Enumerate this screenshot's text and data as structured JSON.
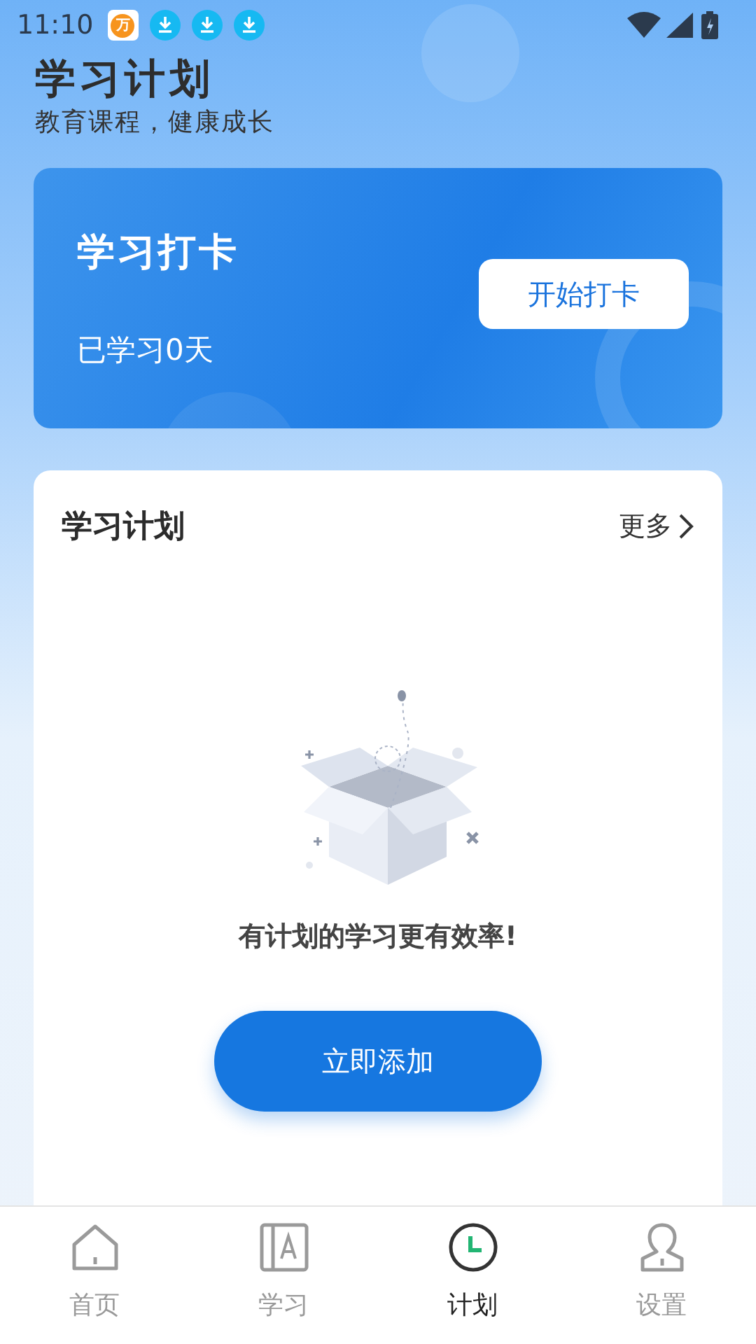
{
  "status_bar": {
    "time": "11:10",
    "notifications": [
      {
        "kind": "app",
        "badge": "万"
      },
      {
        "kind": "download"
      },
      {
        "kind": "download"
      },
      {
        "kind": "download"
      }
    ]
  },
  "header": {
    "title": "学习计划",
    "subtitle": "教育课程，健康成长"
  },
  "checkin_card": {
    "title": "学习打卡",
    "days": "已学习0天",
    "button": "开始打卡"
  },
  "plan_card": {
    "title": "学习计划",
    "more": "更多",
    "empty_message": "有计划的学习更有效率!",
    "add_button": "立即添加"
  },
  "tab_bar": [
    {
      "kind": "home",
      "label": "首页",
      "selected": false
    },
    {
      "kind": "book",
      "label": "学习",
      "selected": false
    },
    {
      "kind": "clock",
      "label": "计划",
      "selected": true
    },
    {
      "kind": "person",
      "label": "设置",
      "selected": false
    }
  ]
}
